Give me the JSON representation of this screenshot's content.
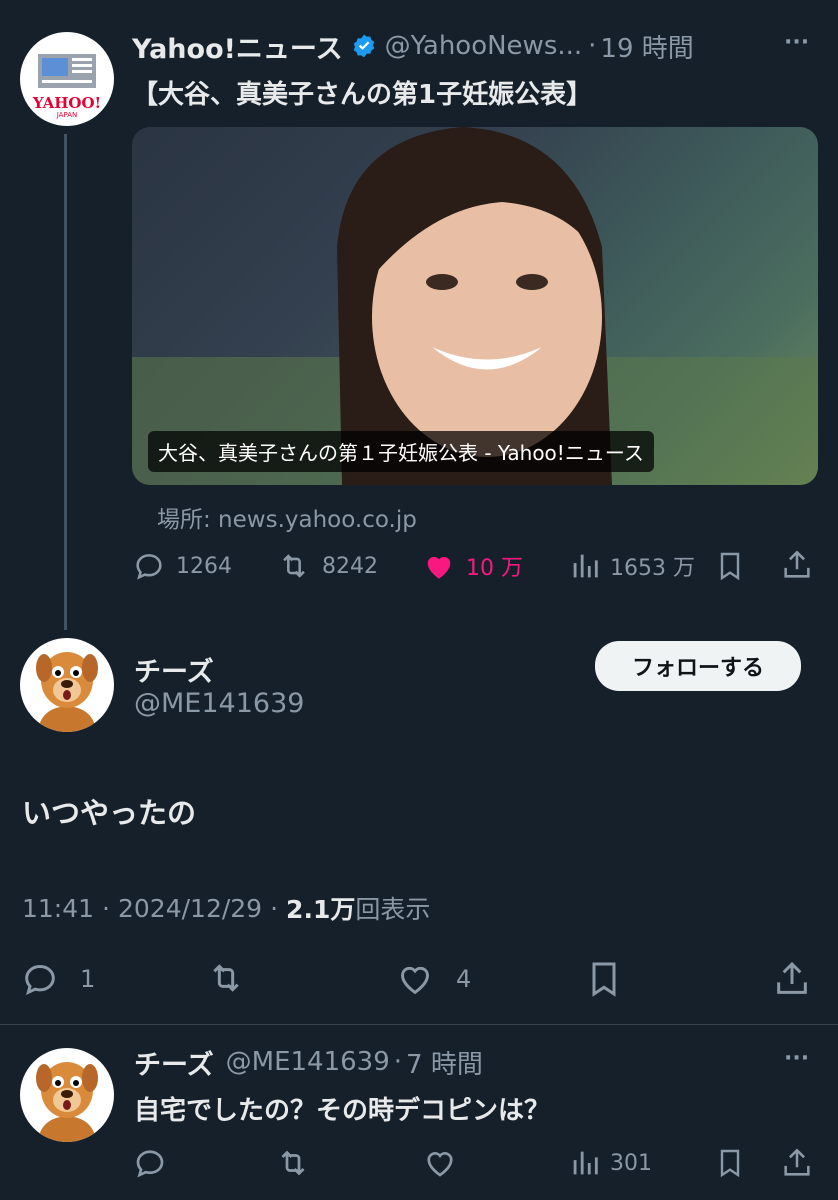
{
  "quoted": {
    "name": "Yahoo!ニュース",
    "handle": "@YahooNews...",
    "sep": "·",
    "time": "19 時間",
    "more": "···",
    "text": "【大谷、真美子さんの第1子妊娠公表】",
    "image_caption": "大谷、真美子さんの第１子妊娠公表 - Yahoo!ニュース",
    "source": "場所: news.yahoo.co.jp",
    "stats": {
      "replies": "1264",
      "retweets": "8242",
      "likes": "10 万",
      "views": "1653 万"
    },
    "avatar_text": "YAHOO!",
    "avatar_subtext": "JAPAN"
  },
  "main": {
    "name": "チーズ",
    "handle": "@ME141639",
    "follow": "フォローする",
    "text": "いつやったの",
    "time": "11:41",
    "date": "2024/12/29",
    "views_count": "2.1万",
    "views_label": "回表示",
    "replies": "1",
    "likes": "4"
  },
  "reply": {
    "name": "チーズ",
    "handle": "@ME141639",
    "sep": "·",
    "time": "7 時間",
    "more": "···",
    "text": "自宅でしたの？その時デコピンは？",
    "views": "301"
  },
  "colors": {
    "like": "#f91880",
    "verified": "#1d9bf0",
    "bg": "#15202b",
    "muted": "#8b98a5"
  }
}
